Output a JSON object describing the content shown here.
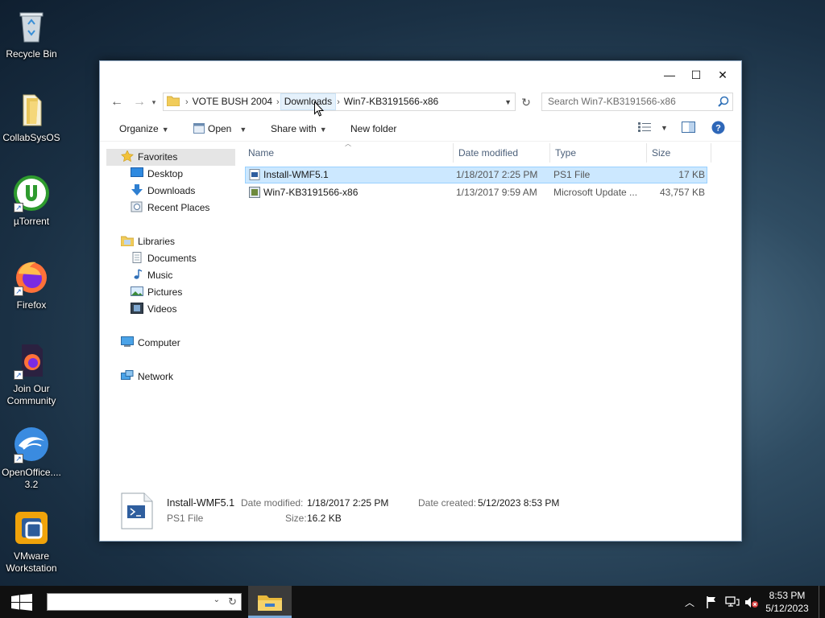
{
  "desktop": {
    "icons": [
      {
        "label": "Recycle Bin",
        "icon": "recycle-bin-icon"
      },
      {
        "label": "CollabSysOS",
        "icon": "folder-icon"
      },
      {
        "label": "µTorrent",
        "icon": "utorrent-icon"
      },
      {
        "label": "Firefox",
        "icon": "firefox-icon"
      },
      {
        "label": "Join Our Community",
        "icon": "firefox-document-icon"
      },
      {
        "label": "OpenOffice.... 3.2",
        "icon": "openoffice-icon"
      },
      {
        "label": "VMware Workstation",
        "icon": "vmware-icon"
      }
    ]
  },
  "window": {
    "controls": {
      "minimize": "—",
      "maximize": "☐",
      "close": "✕"
    },
    "breadcrumb": [
      "VOTE BUSH 2004",
      "Downloads",
      "Win7-KB3191566-x86"
    ],
    "search_placeholder": "Search Win7-KB3191566-x86",
    "toolbar": {
      "organize": "Organize",
      "open": "Open",
      "share_with": "Share with",
      "new_folder": "New folder"
    },
    "nav": {
      "favorites": "Favorites",
      "desktop": "Desktop",
      "downloads": "Downloads",
      "recent_places": "Recent Places",
      "libraries": "Libraries",
      "documents": "Documents",
      "music": "Music",
      "pictures": "Pictures",
      "videos": "Videos",
      "computer": "Computer",
      "network": "Network"
    },
    "columns": {
      "name": "Name",
      "date_modified": "Date modified",
      "type": "Type",
      "size": "Size"
    },
    "files": [
      {
        "name": "Install-WMF5.1",
        "date_modified": "1/18/2017 2:25 PM",
        "type": "PS1 File",
        "size": "17 KB",
        "selected": true
      },
      {
        "name": "Win7-KB3191566-x86",
        "date_modified": "1/13/2017 9:59 AM",
        "type": "Microsoft Update ...",
        "size": "43,757 KB",
        "selected": false
      }
    ],
    "details": {
      "name": "Install-WMF5.1",
      "type": "PS1 File",
      "date_modified_label": "Date modified:",
      "date_modified": "1/18/2017 2:25 PM",
      "size_label": "Size:",
      "size": "16.2 KB",
      "date_created_label": "Date created:",
      "date_created": "5/12/2023 8:53 PM"
    }
  },
  "taskbar": {
    "time": "8:53 PM",
    "date": "5/12/2023"
  },
  "colors": {
    "selection": "#cce8ff",
    "selection_border": "#99d1ff",
    "taskbar": "#101010",
    "header_text": "#4c607a"
  }
}
